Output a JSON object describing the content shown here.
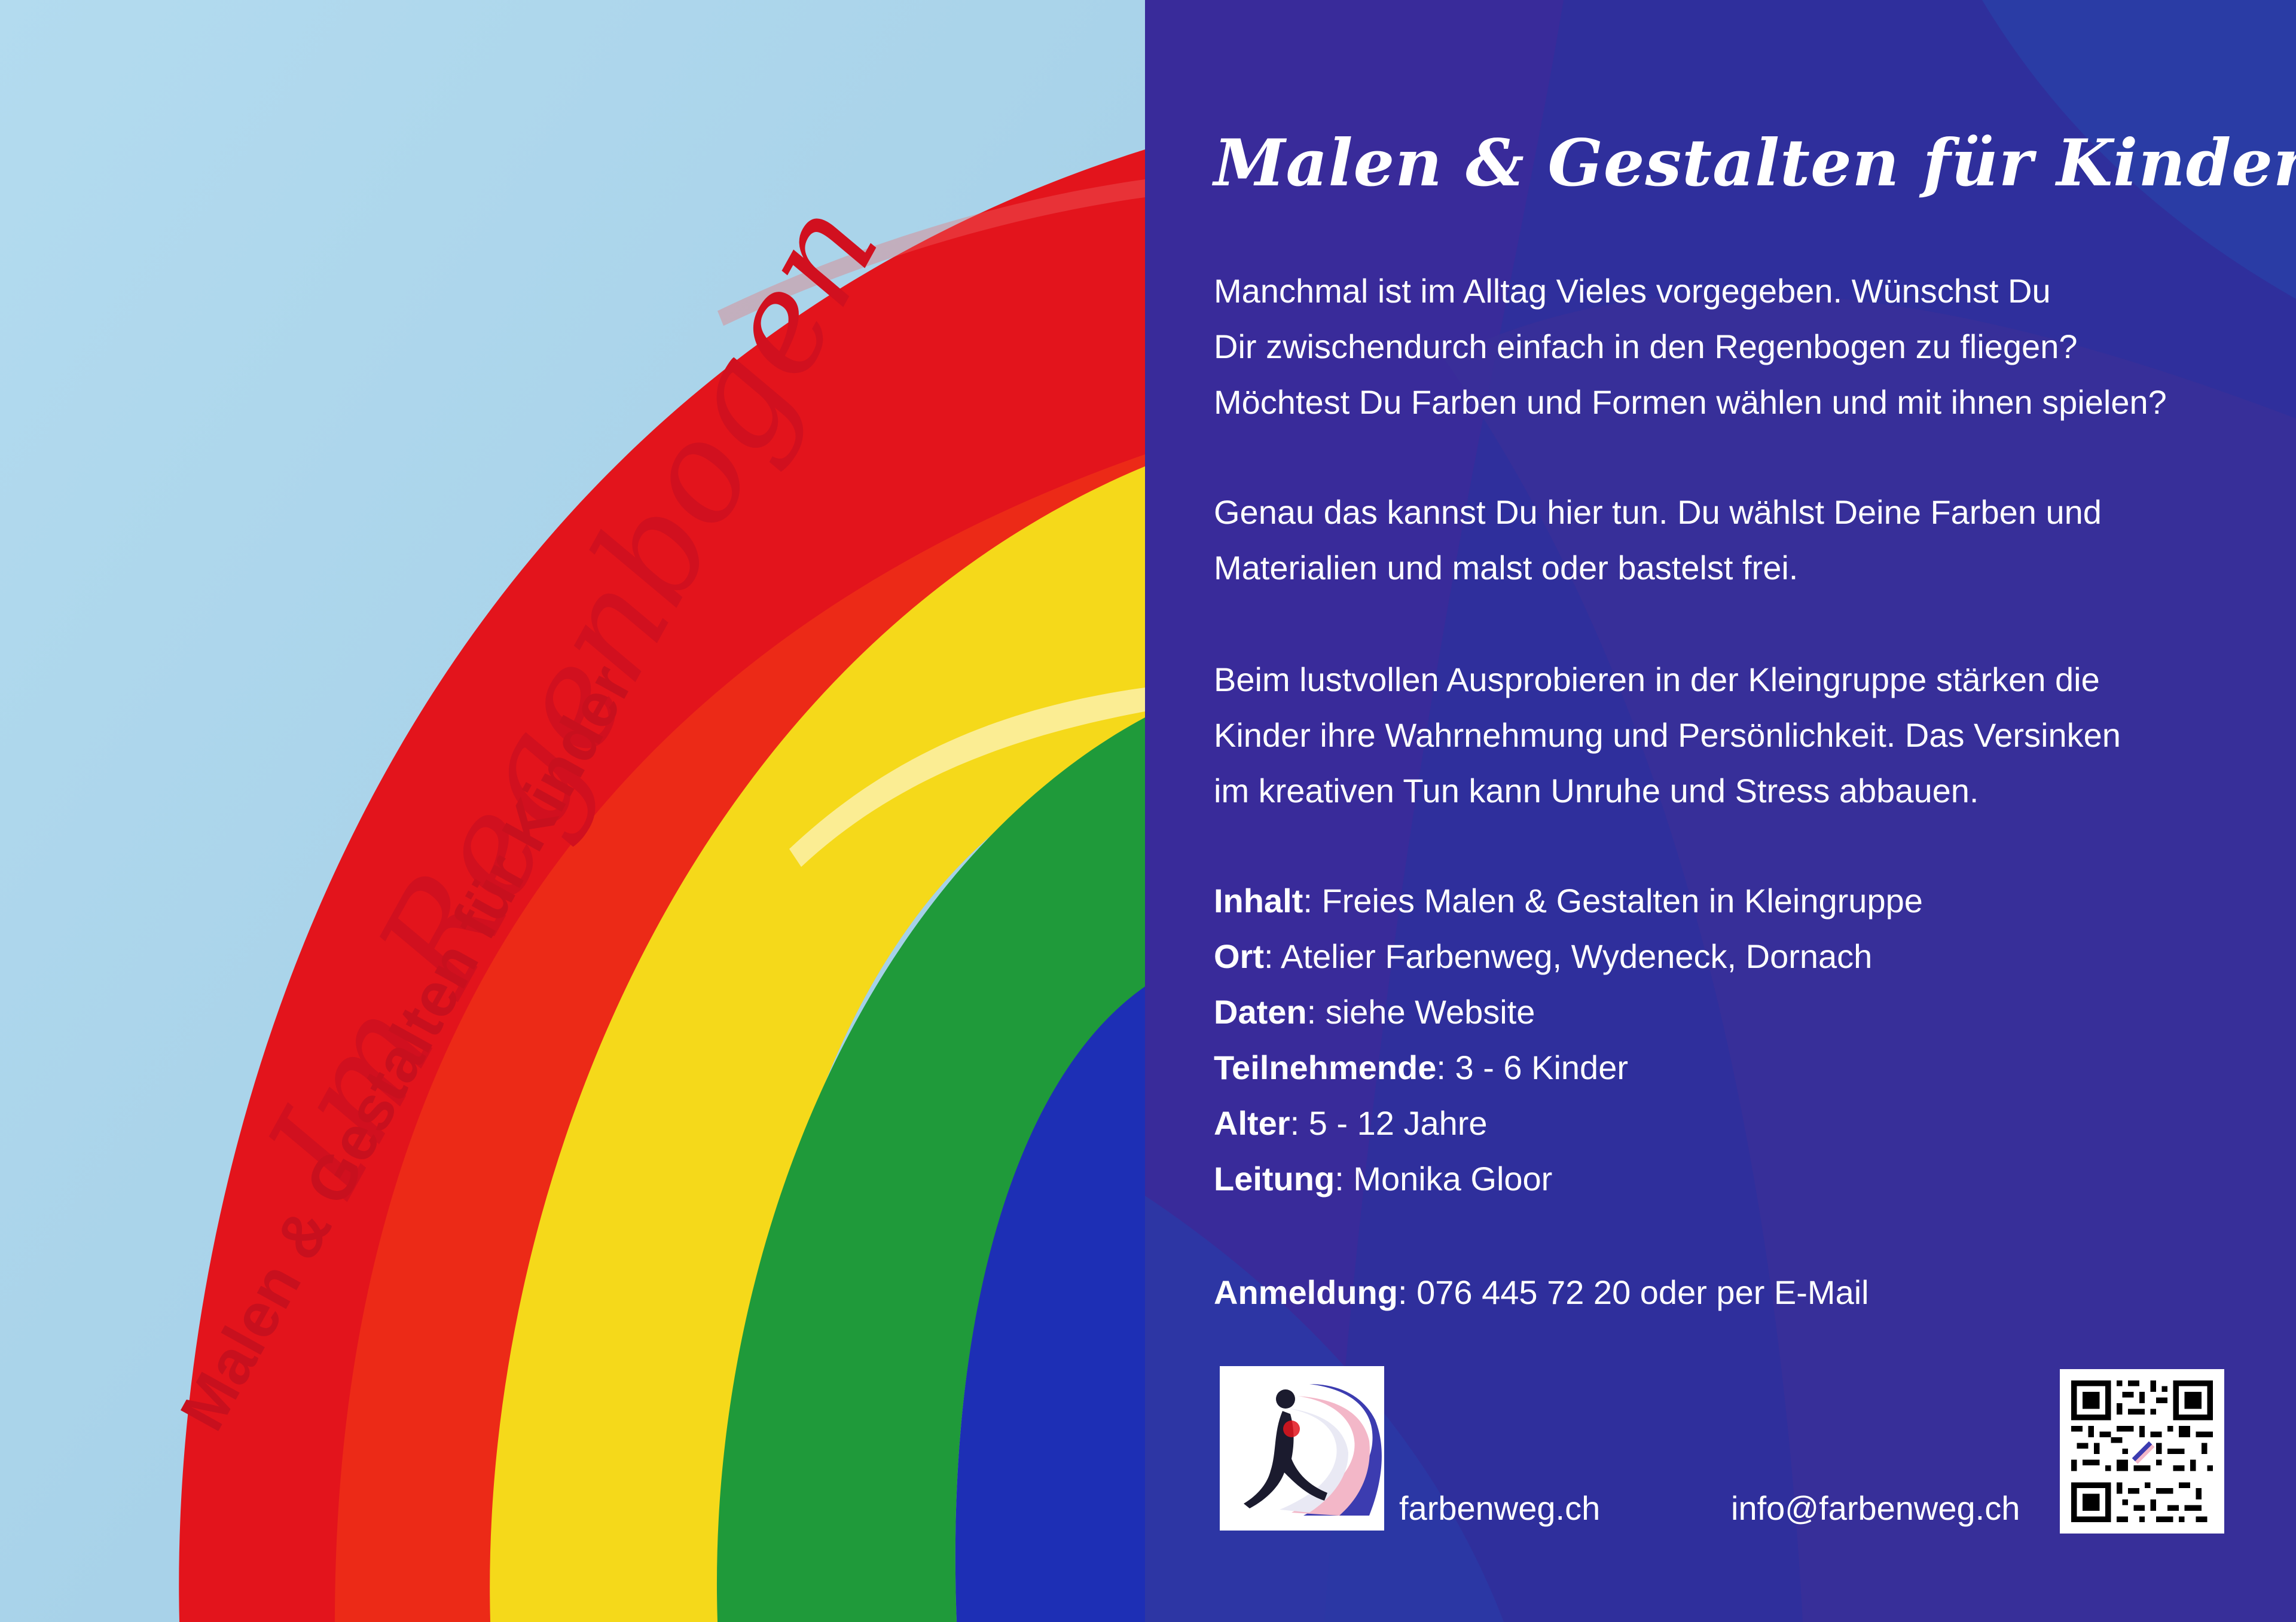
{
  "left_panel": {
    "title": "Im Regenbogen",
    "subtitle": "Malen & Gestalten für Kinder"
  },
  "right_panel": {
    "heading": "Malen & Gestalten für Kinder",
    "paragraph_1": [
      "Manchmal ist im Alltag Vieles vorgegeben. Wünschst Du",
      "Dir zwischendurch einfach in den Regenbogen zu fliegen?",
      "Möchtest Du Farben und Formen wählen und mit ihnen spielen?"
    ],
    "paragraph_2": [
      "Genau das kannst Du hier tun. Du wählst Deine Farben und",
      "Materialien und malst oder bastelst frei."
    ],
    "paragraph_3": [
      "Beim lustvollen Ausprobieren in der Kleingruppe stärken die",
      "Kinder ihre Wahrnehmung und Persönlichkeit. Das Versinken",
      "im kreativen Tun kann Unruhe und Stress abbauen."
    ],
    "details": [
      {
        "label": "Inhalt",
        "value": ": Freies Malen & Gestalten in Kleingruppe"
      },
      {
        "label": "Ort",
        "value": ": Atelier Farbenweg, Wydeneck, Dornach"
      },
      {
        "label": "Daten",
        "value": ": siehe Website"
      },
      {
        "label": "Teilnehmende",
        "value": ": 3 - 6 Kinder"
      },
      {
        "label": "Alter",
        "value": ": 5 - 12 Jahre"
      },
      {
        "label": "Leitung",
        "value": ": Monika Gloor"
      }
    ],
    "signup": {
      "label": "Anmeldung",
      "value": ": 076 445 72 20 oder per E-Mail"
    },
    "website": "farbenweg.ch",
    "email": "info@farbenweg.ch"
  },
  "colors": {
    "sky": "#a8d3ea",
    "red": "#e3141c",
    "yellow": "#f5d91a",
    "green": "#1f9a3a",
    "blue": "#1d2fb5",
    "panel_blue": "#2f2f9c",
    "title_red": "#d1101f"
  },
  "icons": {
    "logo": "running-figure-logo-icon",
    "qr": "qr-code-icon"
  }
}
